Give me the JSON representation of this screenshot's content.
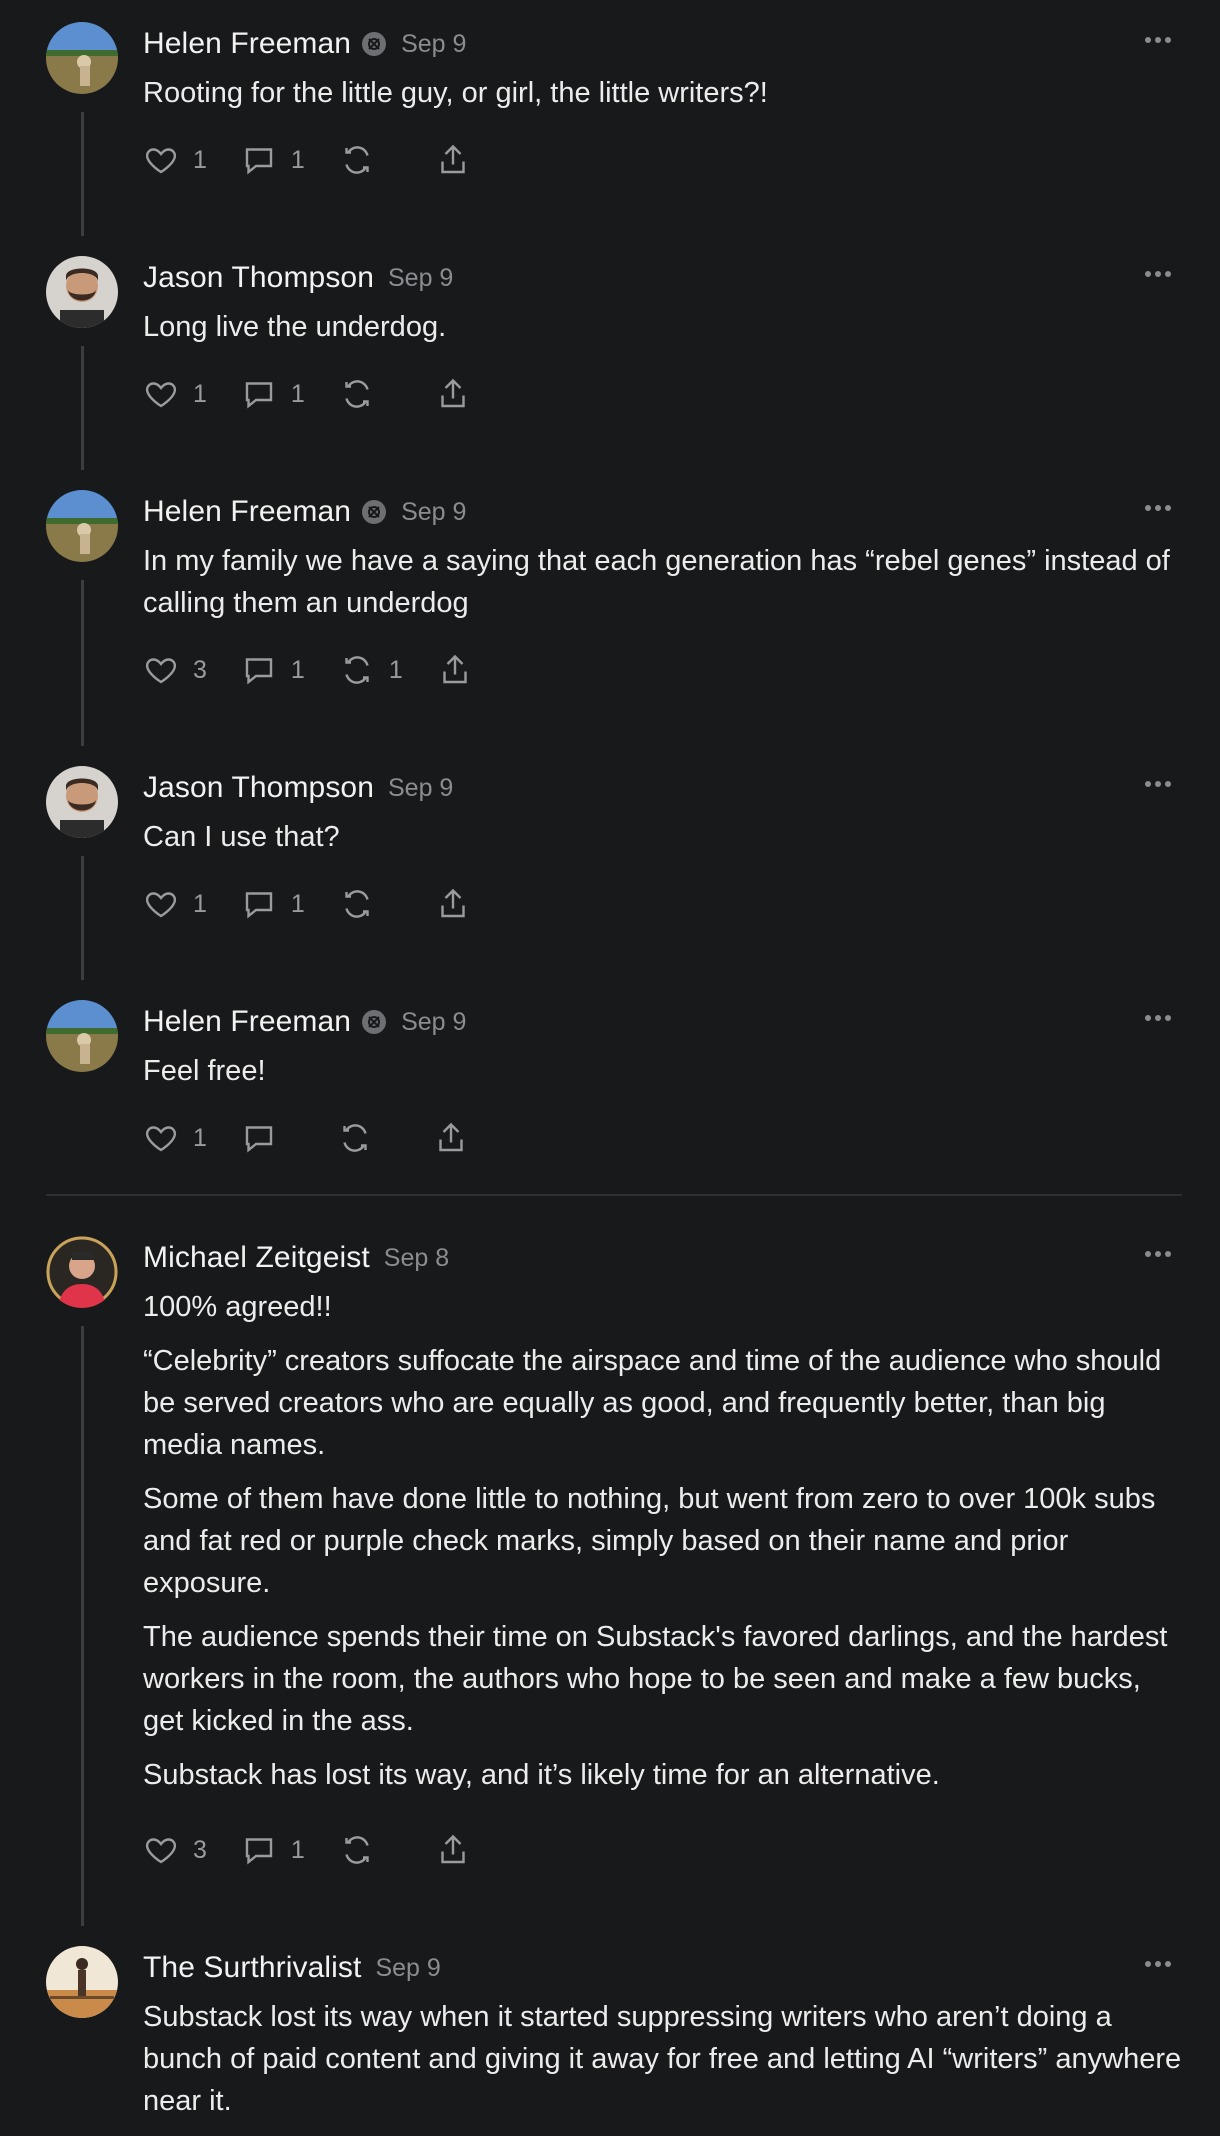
{
  "colors": {
    "background": "#18191b",
    "text": "#ececec",
    "muted": "#8b8c8f",
    "icon": "#9a9b9e"
  },
  "comments": [
    {
      "author": "Helen Freeman",
      "badge": true,
      "date": "Sep 9",
      "paragraphs": [
        "Rooting for the little guy, or girl, the little writers?!"
      ],
      "likes": "1",
      "replies": "1",
      "restacks": ""
    },
    {
      "author": "Jason Thompson",
      "badge": false,
      "date": "Sep 9",
      "paragraphs": [
        "Long live the underdog."
      ],
      "likes": "1",
      "replies": "1",
      "restacks": ""
    },
    {
      "author": "Helen Freeman",
      "badge": true,
      "date": "Sep 9",
      "paragraphs": [
        "In my family we have a saying that each generation has “rebel genes” instead of calling them an underdog"
      ],
      "likes": "3",
      "replies": "1",
      "restacks": "1"
    },
    {
      "author": "Jason Thompson",
      "badge": false,
      "date": "Sep 9",
      "paragraphs": [
        "Can I use that?"
      ],
      "likes": "1",
      "replies": "1",
      "restacks": ""
    },
    {
      "author": "Helen Freeman",
      "badge": true,
      "date": "Sep 9",
      "paragraphs": [
        "Feel free!"
      ],
      "likes": "1",
      "replies": "",
      "restacks": ""
    },
    {
      "author": "Michael Zeitgeist",
      "badge": false,
      "date": "Sep 8",
      "paragraphs": [
        "100% agreed!!",
        "“Celebrity” creators suffocate the airspace and time of the audience who should be served creators who are equally as good, and frequently better, than big media names.",
        "Some of them have done little to nothing, but went from zero to over 100k subs and fat red or purple check marks, simply based on their name and prior exposure.",
        "The audience spends their time on Substack's favored darlings, and the hardest workers in the room, the authors who hope to be seen and make a few bucks, get kicked in the ass.",
        "Substack has lost its way, and it’s likely time for an alternative."
      ],
      "likes": "3",
      "replies": "1",
      "restacks": ""
    },
    {
      "author": "The Surthrivalist",
      "badge": false,
      "date": "Sep 9",
      "paragraphs": [
        "Substack lost its way when it started suppressing writers who aren’t doing a bunch of paid content and giving it away for free and letting AI “writers” anywhere near it."
      ],
      "likes": "",
      "replies": "",
      "restacks": ""
    }
  ]
}
